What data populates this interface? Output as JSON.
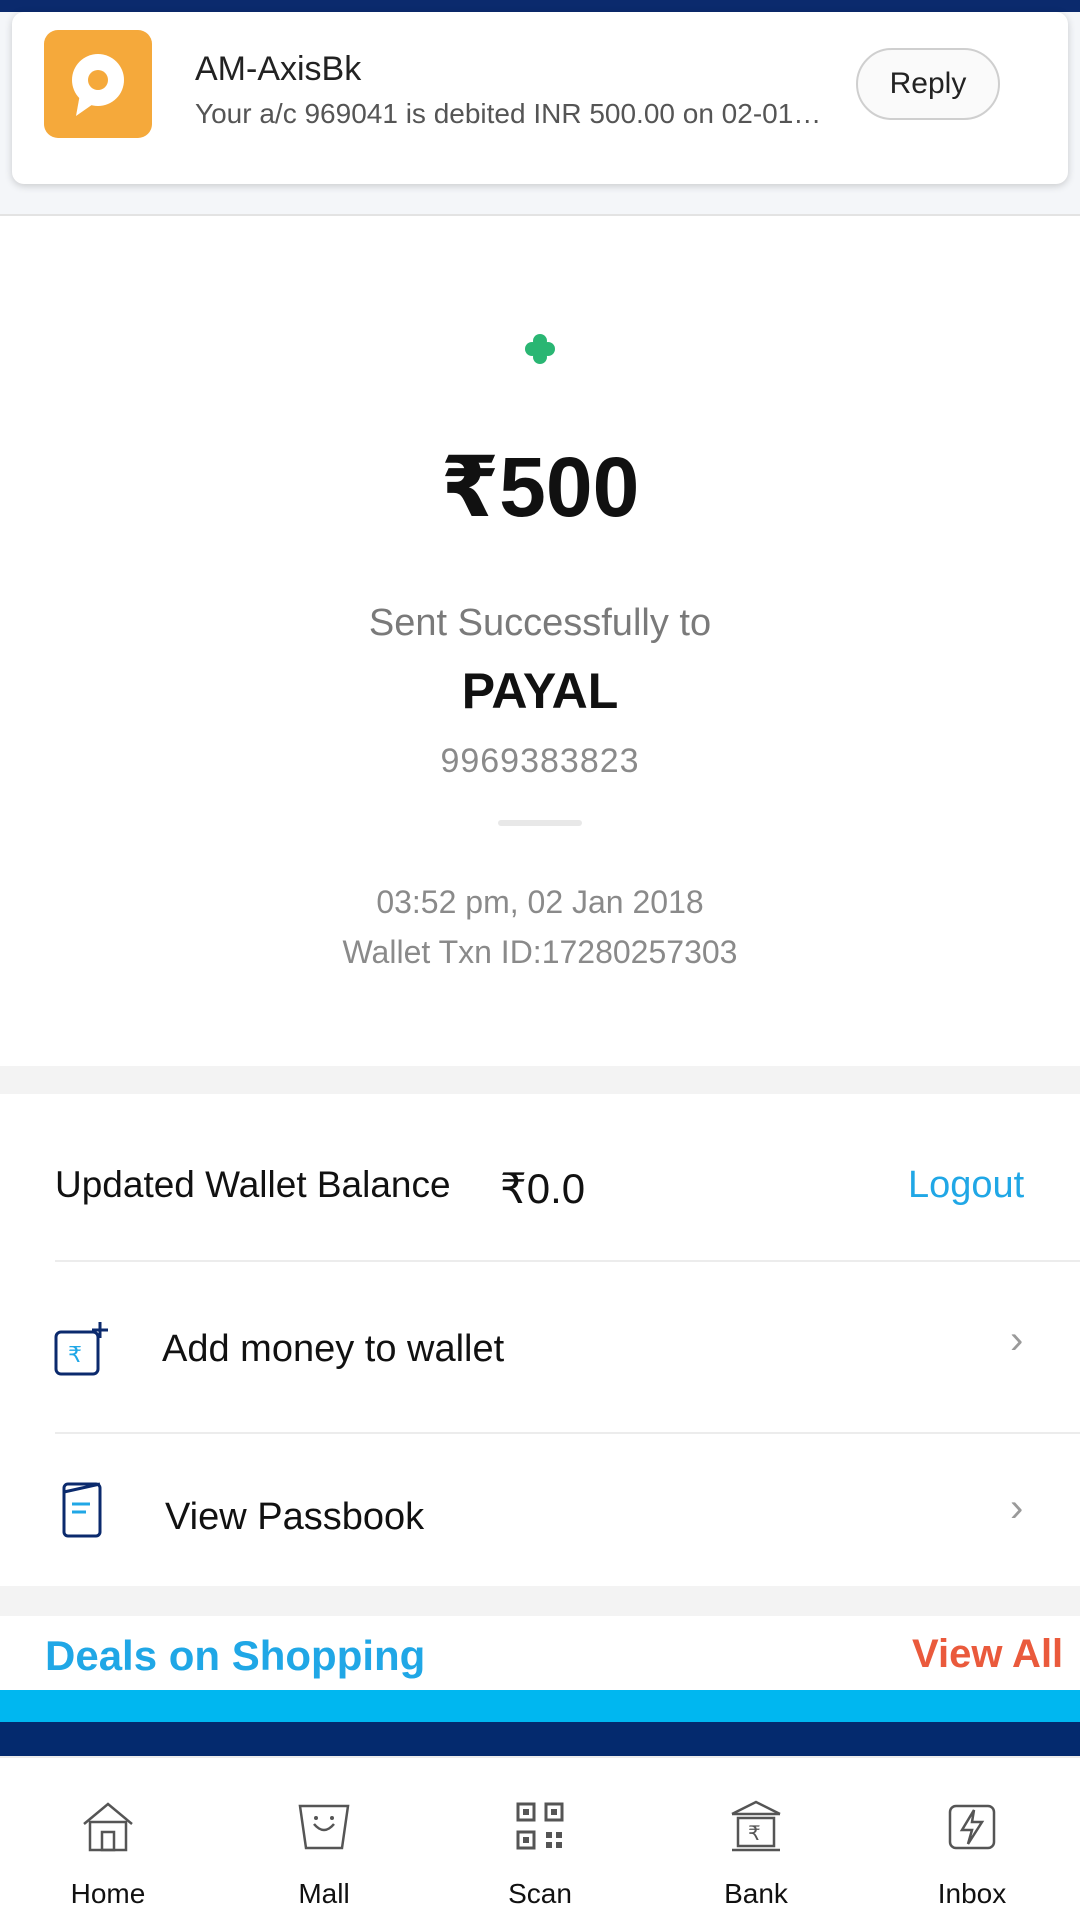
{
  "notification": {
    "app_icon": "message-bubble-icon",
    "sender": "AM-AxisBk",
    "message": "Your a/c 969041 is debited INR 500.00 on 02-01…",
    "reply_label": "Reply"
  },
  "transaction": {
    "status_icon": "success-flower-icon",
    "amount": "₹500",
    "status_text": "Sent Successfully to",
    "recipient_name": "PAYAL",
    "recipient_phone": "9969383823",
    "datetime": "03:52 pm, 02 Jan 2018",
    "wallet_txn_id": "Wallet Txn ID:17280257303"
  },
  "wallet": {
    "balance_label": "Updated Wallet Balance",
    "balance_value": "₹0.0",
    "logout_label": "Logout"
  },
  "actions": [
    {
      "label": "Add money to wallet",
      "icon": "add-money-icon"
    },
    {
      "label": "View Passbook",
      "icon": "passbook-icon"
    }
  ],
  "deals": {
    "title": "Deals on Shopping",
    "view_all": "View All"
  },
  "bottom_nav": [
    {
      "label": "Home",
      "icon": "home-icon"
    },
    {
      "label": "Mall",
      "icon": "mall-bag-icon"
    },
    {
      "label": "Scan",
      "icon": "qr-scan-icon"
    },
    {
      "label": "Bank",
      "icon": "bank-icon"
    },
    {
      "label": "Inbox",
      "icon": "inbox-bolt-icon"
    }
  ],
  "colors": {
    "accent_blue": "#20a7e6",
    "view_all_orange": "#ea5a3c",
    "navy": "#042a6e",
    "cyan_band": "#00b7f0",
    "success_green": "#2ab673",
    "notification_icon_bg": "#f5a93b"
  }
}
